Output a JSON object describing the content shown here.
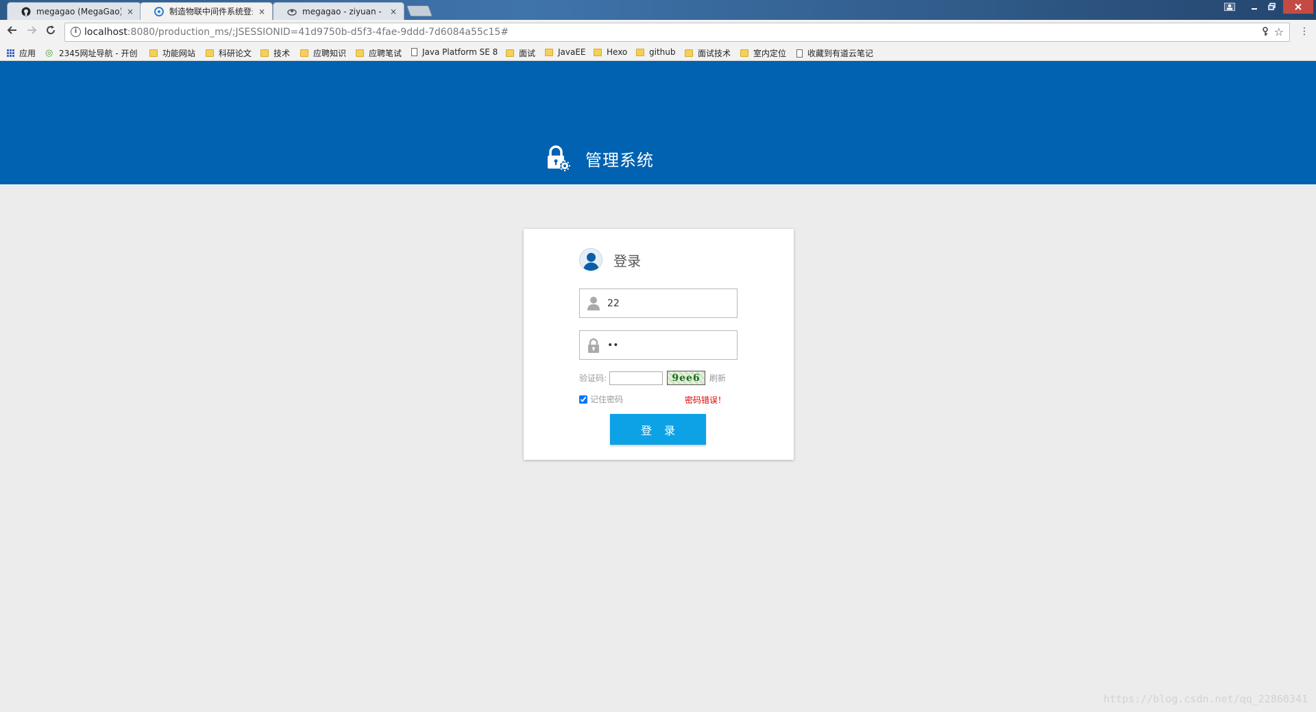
{
  "browser": {
    "tabs": [
      {
        "label": "megagao (MegaGao)",
        "icon": "github-icon",
        "close": "×"
      },
      {
        "label": "制造物联中间件系统登录",
        "icon": "chrome-page-icon",
        "close": "×"
      },
      {
        "label": "megagao - ziyuan - Co",
        "icon": "cloud-icon",
        "close": "×"
      }
    ],
    "url_host": "localhost",
    "url_path": ":8080/production_ms/;JSESSIONID=41d9750b-d5f3-4fae-9ddd-7d6084a55c15#",
    "bookmarks": [
      {
        "label": "应用",
        "type": "apps"
      },
      {
        "label": "2345网址导航 - 开创",
        "type": "site"
      },
      {
        "label": "功能网站",
        "type": "folder"
      },
      {
        "label": "科研论文",
        "type": "folder"
      },
      {
        "label": "技术",
        "type": "folder"
      },
      {
        "label": "应聘知识",
        "type": "folder"
      },
      {
        "label": "应聘笔试",
        "type": "folder"
      },
      {
        "label": "Java Platform SE 8",
        "type": "page"
      },
      {
        "label": "面试",
        "type": "folder"
      },
      {
        "label": "JavaEE",
        "type": "folder"
      },
      {
        "label": "Hexo",
        "type": "folder"
      },
      {
        "label": "github",
        "type": "folder"
      },
      {
        "label": "面试技术",
        "type": "folder"
      },
      {
        "label": "室内定位",
        "type": "folder"
      },
      {
        "label": "收藏到有道云笔记",
        "type": "page"
      }
    ]
  },
  "banner": {
    "title": "管理系统",
    "color": "#0062b0"
  },
  "login": {
    "title": "登录",
    "username_value": "22",
    "password_value": "••",
    "captcha_label": "验证码:",
    "captcha_value": "",
    "captcha_text": "9ee6",
    "refresh_label": "刷新",
    "remember_label": "记住密码",
    "remember_checked": true,
    "error_message": "密码错误！",
    "error_color": "#e00000",
    "button_label": "登录",
    "button_color": "#0da2e6"
  },
  "watermark": "https://blog.csdn.net/qq_22860341"
}
